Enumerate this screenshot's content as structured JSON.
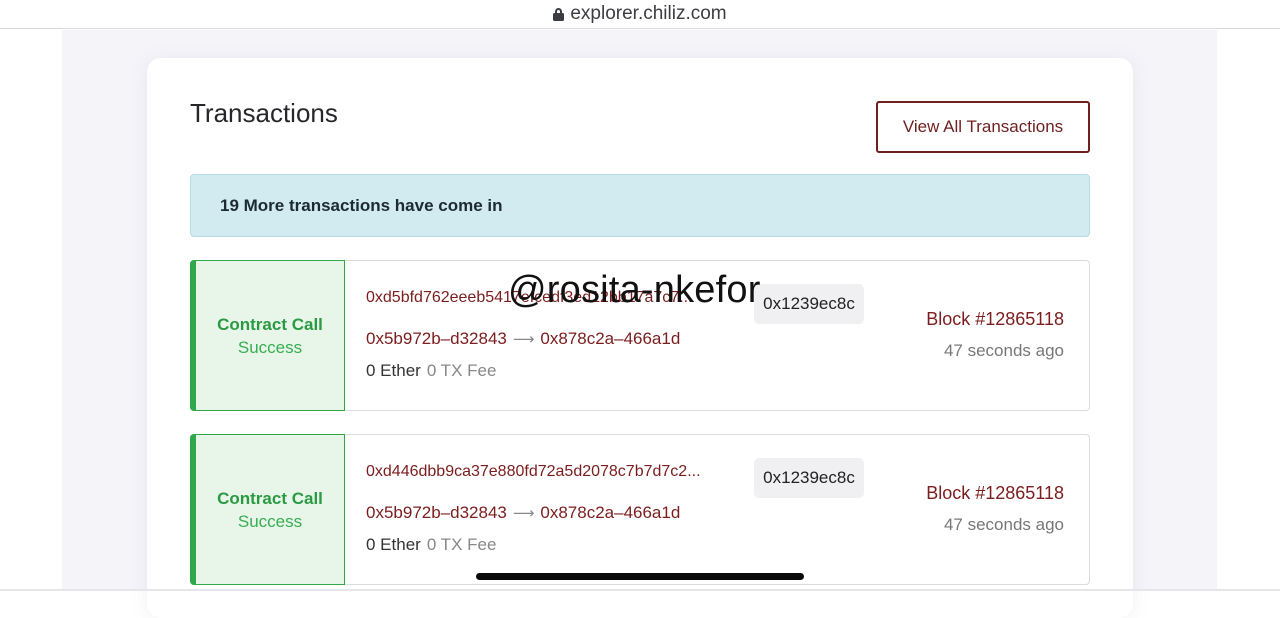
{
  "browser": {
    "url": "explorer.chiliz.com"
  },
  "section": {
    "title": "Transactions",
    "view_all_label": "View All Transactions"
  },
  "alert": {
    "text": "19 More transactions have come in"
  },
  "transactions": [
    {
      "type": "Contract Call",
      "status": "Success",
      "hash": "0xd5bfd762eeeb5417efcedf3ed12bb17a7c7...",
      "method": "0x1239ec8c",
      "from": "0x5b972b–d32843",
      "to": "0x878c2a–466a1d",
      "value": "0 Ether",
      "fee": "0 TX Fee",
      "block": "Block #12865118",
      "age": "47 seconds ago"
    },
    {
      "type": "Contract Call",
      "status": "Success",
      "hash": "0xd446dbb9ca37e880fd72a5d2078c7b7d7c2...",
      "method": "0x1239ec8c",
      "from": "0x5b972b–d32843",
      "to": "0x878c2a–466a1d",
      "value": "0 Ether",
      "fee": "0 TX Fee",
      "block": "Block #12865118",
      "age": "47 seconds ago"
    }
  ],
  "overlay": {
    "watermark": "@rosita-nkefor"
  },
  "icons": {
    "url_lock": "lock-icon",
    "route_arrow": "arrow-right-icon"
  },
  "colors": {
    "accent_success": "#2da84a",
    "link_maroon": "#7b1d1d",
    "alert_bg": "#d1ebf0"
  }
}
